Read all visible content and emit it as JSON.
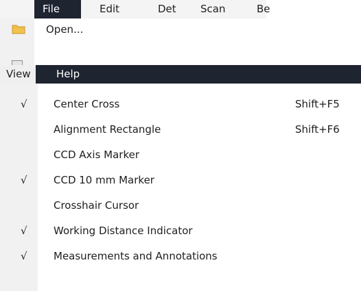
{
  "top_menu": {
    "items": [
      {
        "label": "File"
      },
      {
        "label": "Edit"
      },
      {
        "label": "Det"
      },
      {
        "label": "Scan"
      },
      {
        "label": "Be"
      }
    ]
  },
  "file_menu": {
    "items": [
      {
        "label": "Open...",
        "icon": "folder-icon"
      }
    ]
  },
  "view_bar": {
    "items": [
      {
        "label": "View"
      },
      {
        "label": "Help"
      }
    ]
  },
  "view_menu": {
    "items": [
      {
        "label": "Center Cross",
        "checked": true,
        "check_glyph": "√",
        "shortcut": "Shift+F5"
      },
      {
        "label": "Alignment Rectangle",
        "checked": false,
        "check_glyph": "",
        "shortcut": "Shift+F6"
      },
      {
        "label": "CCD Axis Marker",
        "checked": false,
        "check_glyph": "",
        "shortcut": ""
      },
      {
        "label": "CCD 10 mm Marker",
        "checked": true,
        "check_glyph": "√",
        "shortcut": ""
      },
      {
        "label": "Crosshair Cursor",
        "checked": false,
        "check_glyph": "",
        "shortcut": ""
      },
      {
        "label": "Working Distance Indicator",
        "checked": true,
        "check_glyph": "√",
        "shortcut": ""
      },
      {
        "label": "Measurements and Annotations",
        "checked": true,
        "check_glyph": "√",
        "shortcut": ""
      }
    ]
  },
  "colors": {
    "menubar_dark": "#1e2430",
    "gutter": "#f1f1f1",
    "folder": "#f2c14e"
  }
}
